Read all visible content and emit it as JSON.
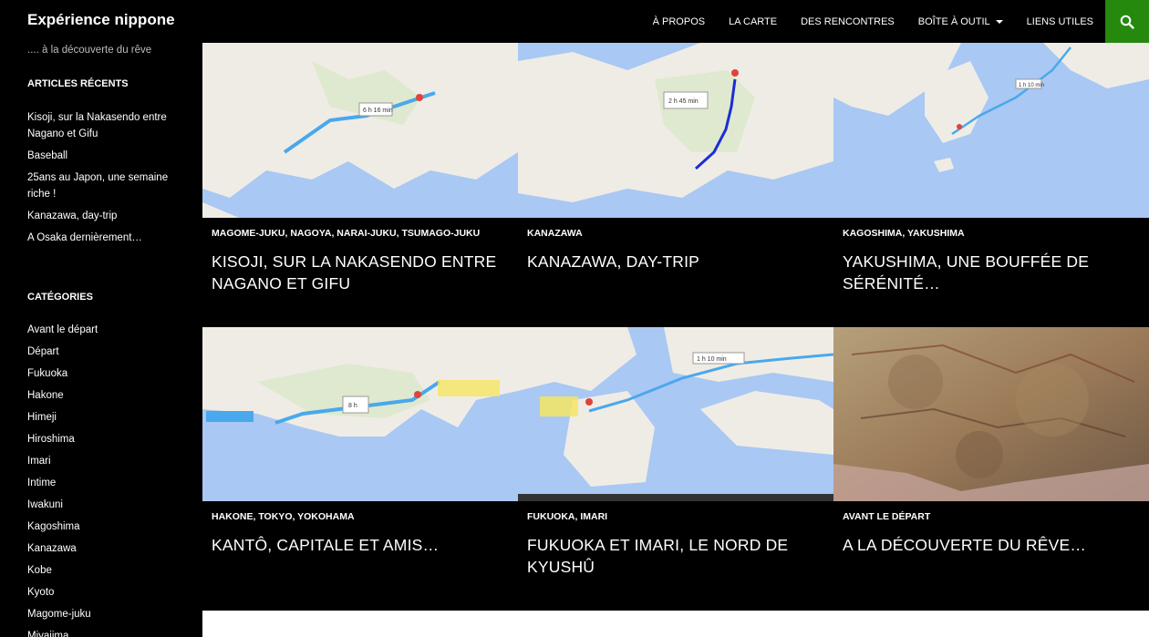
{
  "site": {
    "title": "Expérience nippone",
    "tagline": ".... à la découverte du rêve"
  },
  "nav": [
    {
      "label": "À propos"
    },
    {
      "label": "La carte"
    },
    {
      "label": "Des rencontres"
    },
    {
      "label": "Boîte à outil",
      "has_dropdown": true
    },
    {
      "label": "Liens utiles"
    }
  ],
  "search": {
    "icon": "search-icon",
    "color": "#24890d"
  },
  "sidebar": {
    "recent": {
      "title": "Articles récents",
      "items": [
        "Kisoji, sur la Nakasendo entre Nagano et Gifu",
        "Baseball",
        "25ans au Japon, une semaine riche !",
        "Kanazawa, day-trip",
        "A Osaka dernièrement…"
      ]
    },
    "categories": {
      "title": "Catégories",
      "items": [
        "Avant le départ",
        "Départ",
        "Fukuoka",
        "Hakone",
        "Himeji",
        "Hiroshima",
        "Imari",
        "Intime",
        "Iwakuni",
        "Kagoshima",
        "Kanazawa",
        "Kobe",
        "Kyoto",
        "Magome-juku",
        "Miyajima"
      ]
    }
  },
  "posts": [
    {
      "cats": "Magome-juku, Nagoya, Narai-juku, Tsumago-juku",
      "title": "Kisoji, sur la Nakasendo entre Nagano et Gifu",
      "thumb": "map-route-kisoji",
      "map_label": "6 h 16 min"
    },
    {
      "cats": "Kanazawa",
      "title": "Kanazawa, day-trip",
      "thumb": "map-route-kanazawa",
      "map_label": "2 h 45 min"
    },
    {
      "cats": "Kagoshima, Yakushima",
      "title": "Yakushima, une bouffée de sérénité…",
      "thumb": "map-route-yakushima",
      "map_label": "1 h 10 min"
    },
    {
      "cats": "Hakone, Tokyo, Yokohama",
      "title": "Kantô, capitale et amis…",
      "thumb": "map-route-kanto",
      "map_label": "8 h"
    },
    {
      "cats": "Fukuoka, Imari",
      "title": "Fukuoka et Imari, le nord de Kyushû",
      "thumb": "map-route-fukuoka",
      "map_label": "1 h 10 min"
    },
    {
      "cats": "Avant le départ",
      "title": "A la découverte du rêve…",
      "thumb": "vintage-map-kansai"
    }
  ],
  "colors": {
    "accent": "#24890d",
    "map_sea": "#a9c8f3",
    "map_land": "#efece6",
    "route": "#4aa8ec"
  }
}
